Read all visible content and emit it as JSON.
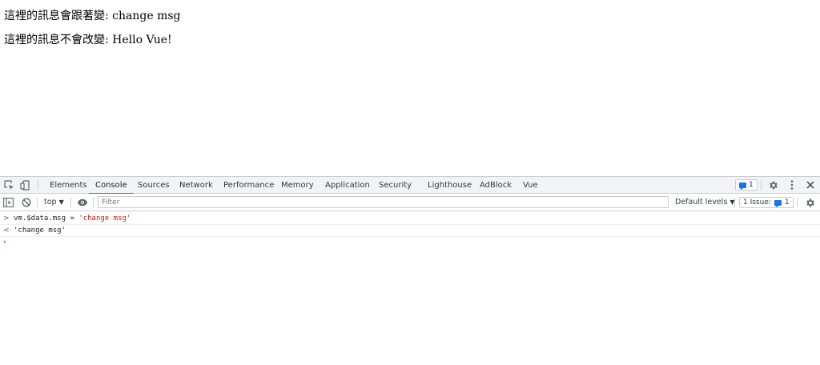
{
  "page": {
    "line1": {
      "label": "這裡的訊息會跟著變:",
      "value": "change msg"
    },
    "line2": {
      "label": "這裡的訊息不會改變:",
      "value": "Hello Vue!"
    }
  },
  "devtools": {
    "tabs": [
      "Elements",
      "Console",
      "Sources",
      "Network",
      "Performance",
      "Memory",
      "Application",
      "Security",
      "Lighthouse",
      "AdBlock",
      "Vue"
    ],
    "active_tab": "Console",
    "issues_count": "1",
    "toolbar": {
      "context": "top",
      "filter_placeholder": "Filter",
      "levels": "Default levels",
      "issues_label": "1 Issue:",
      "issues_count": "1"
    },
    "console": {
      "input": {
        "prefix": "vm.$data.msg = ",
        "string": "'change msg'"
      },
      "output": "'change msg'"
    },
    "icons": [
      "inspect-icon",
      "device-toolbar-icon",
      "settings-icon",
      "more-vert-icon",
      "close-icon",
      "sidebar-toggle-icon",
      "clear-console-icon",
      "eye-icon"
    ],
    "colors": {
      "accent": "#1a73e8",
      "string": "#c41a16"
    }
  }
}
